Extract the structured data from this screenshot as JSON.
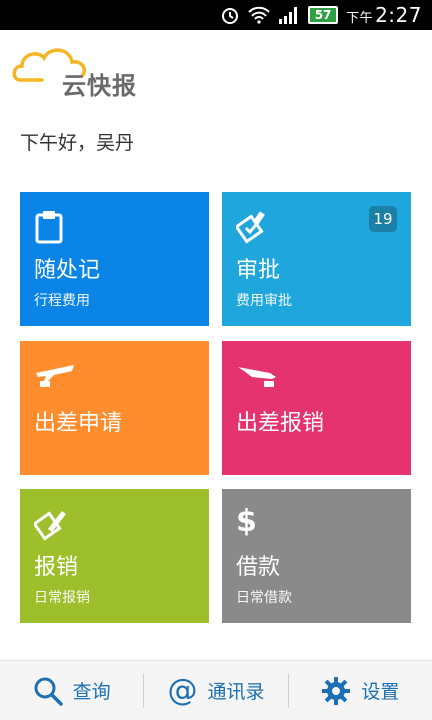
{
  "status_bar": {
    "battery": "57",
    "time_prefix": "下午",
    "time": "2:27"
  },
  "app": {
    "logo_text": "云快报"
  },
  "greeting": "下午好，吴丹",
  "tiles": [
    {
      "title": "随处记",
      "subtitle": "行程费用",
      "color": "#0a84e6",
      "icon": "clipboard-icon"
    },
    {
      "title": "审批",
      "subtitle": "费用审批",
      "color": "#1fa6dc",
      "icon": "approve-stamp-icon",
      "badge": "19"
    },
    {
      "title": "出差申请",
      "subtitle": "",
      "color": "#ff8d2e",
      "icon": "plane-takeoff-icon"
    },
    {
      "title": "出差报销",
      "subtitle": "",
      "color": "#e4336e",
      "icon": "plane-landing-icon"
    },
    {
      "title": "报销",
      "subtitle": "日常报销",
      "color": "#9ebf2c",
      "icon": "pen-edit-icon"
    },
    {
      "title": "借款",
      "subtitle": "日常借款",
      "color": "#8a8a8a",
      "icon": "dollar-icon"
    }
  ],
  "bottom_bar": {
    "items": [
      {
        "label": "查询",
        "icon": "search-icon"
      },
      {
        "label": "通讯录",
        "icon": "at-icon"
      },
      {
        "label": "设置",
        "icon": "gear-icon"
      }
    ],
    "accent": "#1a6fb5"
  }
}
